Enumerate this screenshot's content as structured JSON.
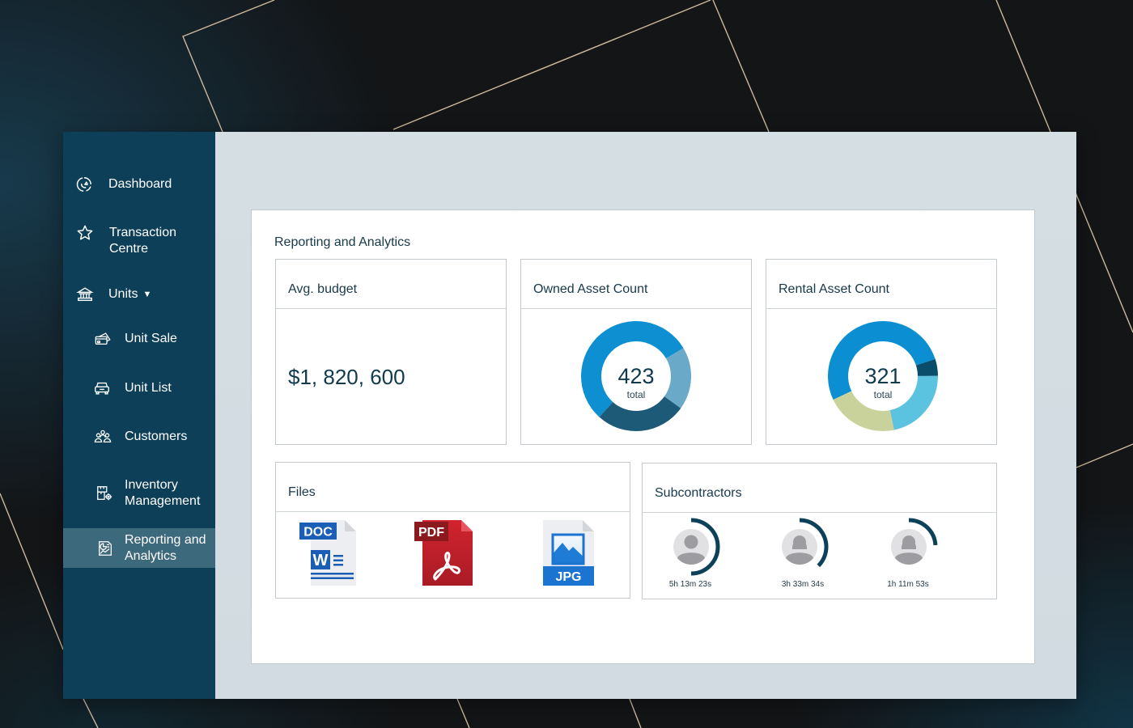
{
  "sidebar": {
    "items": [
      {
        "label": "Dashboard",
        "icon": "dashboard-icon",
        "active": false
      },
      {
        "label": "Transaction Centre",
        "icon": "star-icon",
        "active": false
      },
      {
        "label": "Units",
        "icon": "bank-icon",
        "active": false,
        "caret": "▼"
      },
      {
        "label": "Unit Sale",
        "icon": "cards-icon",
        "active": false
      },
      {
        "label": "Unit List",
        "icon": "car-icon",
        "active": false
      },
      {
        "label": "Customers",
        "icon": "people-icon",
        "active": false
      },
      {
        "label": "Inventory Management",
        "icon": "inventory-icon",
        "active": false
      },
      {
        "label": "Reporting and Analytics",
        "icon": "report-icon",
        "active": true
      }
    ]
  },
  "page": {
    "title": "Reporting and Analytics"
  },
  "cards": {
    "avg_budget": {
      "title": "Avg. budget",
      "value": "$1, 820, 600"
    },
    "owned_assets": {
      "title": "Owned Asset Count"
    },
    "rental_assets": {
      "title": "Rental Asset Count"
    },
    "files": {
      "title": "Files",
      "items": [
        {
          "type": "DOC",
          "icon": "doc-file-icon",
          "badge_color": "#1a5fb5"
        },
        {
          "type": "PDF",
          "icon": "pdf-file-icon",
          "badge_color": "#8b1a1f"
        },
        {
          "type": "JPG",
          "icon": "jpg-file-icon",
          "badge_color": "#1b74d0"
        }
      ]
    },
    "subcontractors": {
      "title": "Subcontractors",
      "items": [
        {
          "time": "5h 13m 23s",
          "avatar": "male-avatar-icon",
          "progress": 0.5
        },
        {
          "time": "3h 33m 34s",
          "avatar": "female-avatar-icon",
          "progress": 0.375
        },
        {
          "time": "1h 11m 53s",
          "avatar": "female-avatar-icon",
          "progress": 0.24
        }
      ],
      "arc_color": "#0d4059"
    }
  },
  "chart_data": [
    {
      "type": "pie",
      "title": "Owned Asset Count",
      "center_value": "423",
      "center_label": "total",
      "total": 423,
      "values": [
        232,
        78,
        113
      ],
      "colors": [
        "#0d8fd1",
        "#6aa9c8",
        "#1c5a78"
      ]
    },
    {
      "type": "pie",
      "title": "Rental Asset Count",
      "center_value": "321",
      "center_label": "total",
      "total": 321,
      "values": [
        167,
        16,
        70,
        68
      ],
      "colors": [
        "#0b8fd2",
        "#0a4d6b",
        "#5bc3e0",
        "#c9d29a"
      ]
    }
  ],
  "theme": {
    "sidebar_bg": "#0d4058",
    "sidebar_active_bg": "#3d697c",
    "text_dark": "#17394a"
  }
}
